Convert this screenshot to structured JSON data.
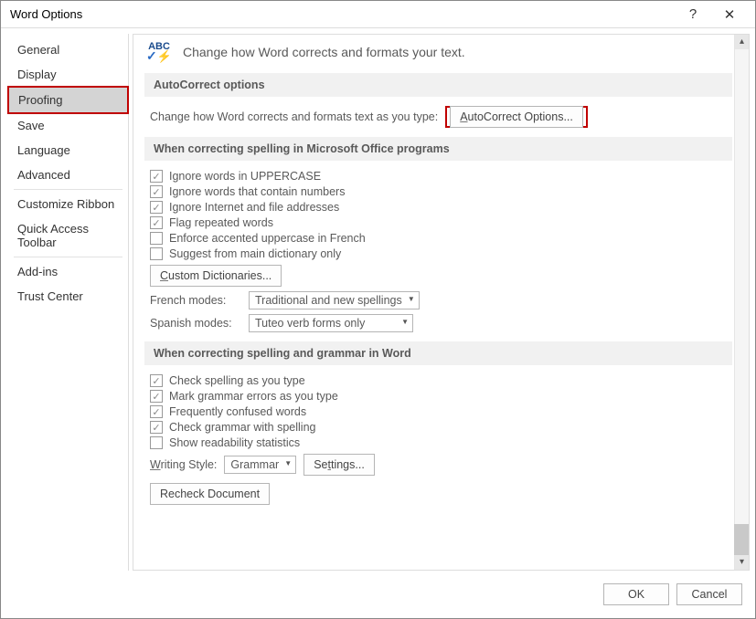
{
  "window": {
    "title": "Word Options"
  },
  "sidebar": {
    "items": [
      "General",
      "Display",
      "Proofing",
      "Save",
      "Language",
      "Advanced",
      "Customize Ribbon",
      "Quick Access Toolbar",
      "Add-ins",
      "Trust Center"
    ],
    "selected": "Proofing"
  },
  "header": {
    "text": "Change how Word corrects and formats your text."
  },
  "sections": {
    "autocorrect": {
      "title": "AutoCorrect options",
      "desc": "Change how Word corrects and formats text as you type:",
      "button": "AutoCorrect Options..."
    },
    "spelling_office": {
      "title": "When correcting spelling in Microsoft Office programs",
      "checks": [
        {
          "label": "Ignore words in UPPERCASE",
          "checked": true
        },
        {
          "label": "Ignore words that contain numbers",
          "checked": true
        },
        {
          "label": "Ignore Internet and file addresses",
          "checked": true
        },
        {
          "label": "Flag repeated words",
          "checked": true
        },
        {
          "label": "Enforce accented uppercase in French",
          "checked": false
        },
        {
          "label": "Suggest from main dictionary only",
          "checked": false
        }
      ],
      "custom_dict_button": "Custom Dictionaries...",
      "french_label": "French modes:",
      "french_value": "Traditional and new spellings",
      "spanish_label": "Spanish modes:",
      "spanish_value": "Tuteo verb forms only"
    },
    "spelling_word": {
      "title": "When correcting spelling and grammar in Word",
      "checks": [
        {
          "label": "Check spelling as you type",
          "checked": true
        },
        {
          "label": "Mark grammar errors as you type",
          "checked": true
        },
        {
          "label": "Frequently confused words",
          "checked": true
        },
        {
          "label": "Check grammar with spelling",
          "checked": true
        },
        {
          "label": "Show readability statistics",
          "checked": false
        }
      ],
      "writing_style_label": "Writing Style:",
      "writing_style_value": "Grammar",
      "settings_button": "Settings...",
      "recheck_button": "Recheck Document"
    }
  },
  "footer": {
    "ok": "OK",
    "cancel": "Cancel"
  }
}
